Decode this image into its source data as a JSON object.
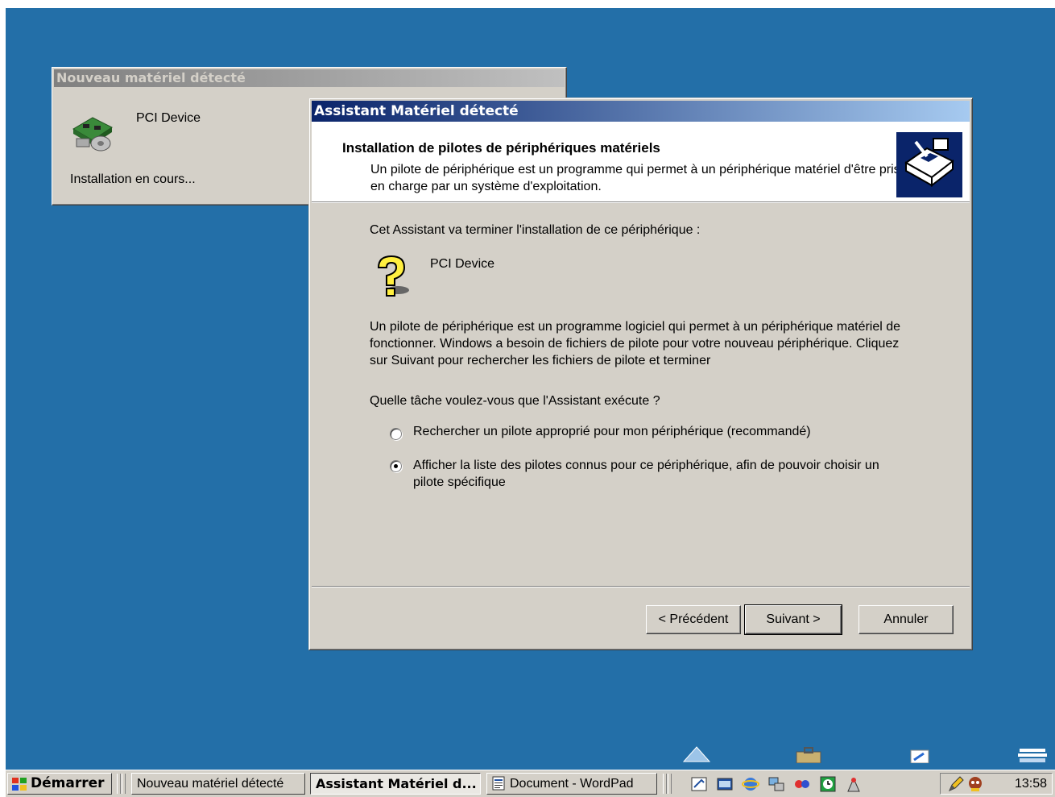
{
  "bg_window": {
    "title": "Nouveau matériel détecté",
    "device_name": "PCI Device",
    "status": "Installation en cours..."
  },
  "wizard": {
    "title": "Assistant Matériel détecté",
    "header_title": "Installation de pilotes de périphériques matériels",
    "header_subtitle": "Un pilote de périphérique est un programme qui permet à un périphérique matériel d'être pris en charge par un système d'exploitation.",
    "intro": "Cet Assistant va terminer l'installation de ce périphérique :",
    "device_name": "PCI Device",
    "paragraph": "Un pilote de périphérique est un programme logiciel qui permet à un périphérique matériel de fonctionner. Windows a besoin de fichiers de pilote pour votre nouveau périphérique. Cliquez sur Suivant pour rechercher les fichiers de pilote et terminer",
    "question": "Quelle tâche voulez-vous que l'Assistant exécute ?",
    "options": [
      {
        "label": "Rechercher un pilote approprié pour mon périphérique (recommandé)",
        "checked": false
      },
      {
        "label": "Afficher la liste des pilotes connus pour ce périphérique, afin de pouvoir choisir un pilote spécifique",
        "checked": true
      }
    ],
    "buttons": {
      "back": "< Précédent",
      "next": "Suivant >",
      "cancel": "Annuler"
    }
  },
  "taskbar": {
    "start_label": "Démarrer",
    "tasks": [
      {
        "label": "Nouveau matériel détecté",
        "active": false
      },
      {
        "label": "Assistant Matériel d...",
        "active": true
      },
      {
        "label": "Document - WordPad",
        "active": false
      }
    ],
    "quicklaunch_icons": [
      "show-desktop-icon",
      "terminal-icon",
      "internet-explorer-icon",
      "network-icon",
      "media-icon",
      "clock-app-icon",
      "tool-icon"
    ],
    "tray_icons": [
      "pencil-icon",
      "agent-icon"
    ],
    "clock": "13:58"
  },
  "colors": {
    "desktop": "#236fa8",
    "title_active_start": "#0a246a",
    "title_active_end": "#a6caf0",
    "face": "#d4d0c8"
  }
}
